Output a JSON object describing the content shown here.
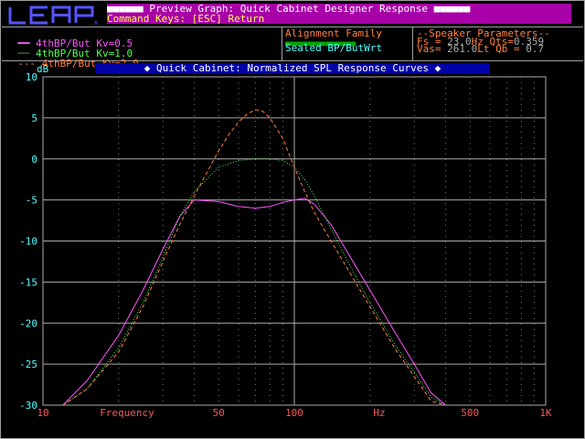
{
  "window": {
    "logo_text": "LEAP",
    "title_line1": "■■■■■■ Preview Graph: Quick Cabinet Designer Response ■■■■■■",
    "title_line2": "Command Keys: [ESC] Return"
  },
  "legend": {
    "items": [
      {
        "symbol": "—",
        "label": "4thBP/But Kv=0.5",
        "color": "#ff55ff"
      },
      {
        "symbol": "···",
        "label": "4thBP/But Kv=1.0",
        "color": "#55ff55"
      },
      {
        "symbol": "---",
        "label": "4thBP/But Kv=2.0",
        "color": "#ff8040"
      }
    ]
  },
  "alignment": {
    "heading": "Alignment Family",
    "dots": "■■■■■■■■■■■■■■■■",
    "value": "Sealed BP/ButWrt"
  },
  "speaker": {
    "heading": "--Speaker Parameters--",
    "row1_left": "Fs =",
    "row1_fs": "23.0",
    "row1_unit": "Hz",
    "row1_qts_label": "Qts=",
    "row1_qts": "0.359",
    "row2_left": "Vas=",
    "row2_vas": "261.0",
    "row2_unit": "Lt",
    "row2_qb_label": "Qb =",
    "row2_qb": "0.7"
  },
  "chart_data": {
    "type": "line",
    "title": "◆ Quick Cabinet: Normalized SPL Response Curves ◆",
    "ylabel": "dB",
    "xlabel": "Frequency",
    "xunit": "Hz",
    "x_scale": "log",
    "xlim": [
      10,
      1000
    ],
    "ylim": [
      -30,
      10
    ],
    "x_ticks": [
      {
        "value": 10,
        "label": "10"
      },
      {
        "value": 50,
        "label": "50"
      },
      {
        "value": 100,
        "label": "100"
      },
      {
        "value": 500,
        "label": "500"
      },
      {
        "value": 1000,
        "label": "1K"
      }
    ],
    "y_ticks": [
      10,
      5,
      0,
      -5,
      -10,
      -15,
      -20,
      -25,
      -30
    ],
    "grid": true,
    "series": [
      {
        "name": "4thBP/But Kv=0.5",
        "color": "#ff55ff",
        "dash": "solid",
        "x": [
          12,
          15,
          20,
          25,
          30,
          35,
          40,
          50,
          60,
          70,
          80,
          90,
          100,
          110,
          120,
          140,
          160,
          200,
          250,
          300,
          350,
          400
        ],
        "y": [
          -30,
          -27,
          -21.5,
          -16,
          -11,
          -7,
          -5,
          -5.2,
          -5.8,
          -6,
          -5.8,
          -5.3,
          -5,
          -4.8,
          -5.5,
          -8,
          -11,
          -16,
          -21,
          -25,
          -28.5,
          -30
        ]
      },
      {
        "name": "4thBP/But Kv=1.0",
        "color": "#55ff55",
        "dash": "dotted",
        "x": [
          12,
          15,
          20,
          25,
          30,
          35,
          40,
          50,
          60,
          70,
          80,
          90,
          100,
          110,
          120,
          140,
          160,
          200,
          250,
          300,
          350,
          400
        ],
        "y": [
          -30,
          -28,
          -23,
          -17.5,
          -12,
          -7,
          -4,
          -1,
          -0.2,
          0,
          0,
          -0.2,
          -1,
          -2.5,
          -4.5,
          -8.5,
          -12,
          -17.5,
          -22.5,
          -26,
          -29,
          -30
        ]
      },
      {
        "name": "4thBP/But Kv=2.0",
        "color": "#ff8040",
        "dash": "dashed",
        "x": [
          12,
          15,
          20,
          25,
          30,
          35,
          40,
          50,
          55,
          60,
          65,
          70,
          75,
          80,
          90,
          100,
          110,
          120,
          140,
          160,
          200,
          250,
          300,
          350,
          400
        ],
        "y": [
          -30,
          -28,
          -23.5,
          -18,
          -12.5,
          -8,
          -4.5,
          1,
          3,
          4.5,
          5.5,
          6,
          5.8,
          5,
          2.5,
          -1,
          -4,
          -6.5,
          -10,
          -13,
          -18,
          -23,
          -26.5,
          -29.5,
          -30
        ]
      }
    ]
  }
}
